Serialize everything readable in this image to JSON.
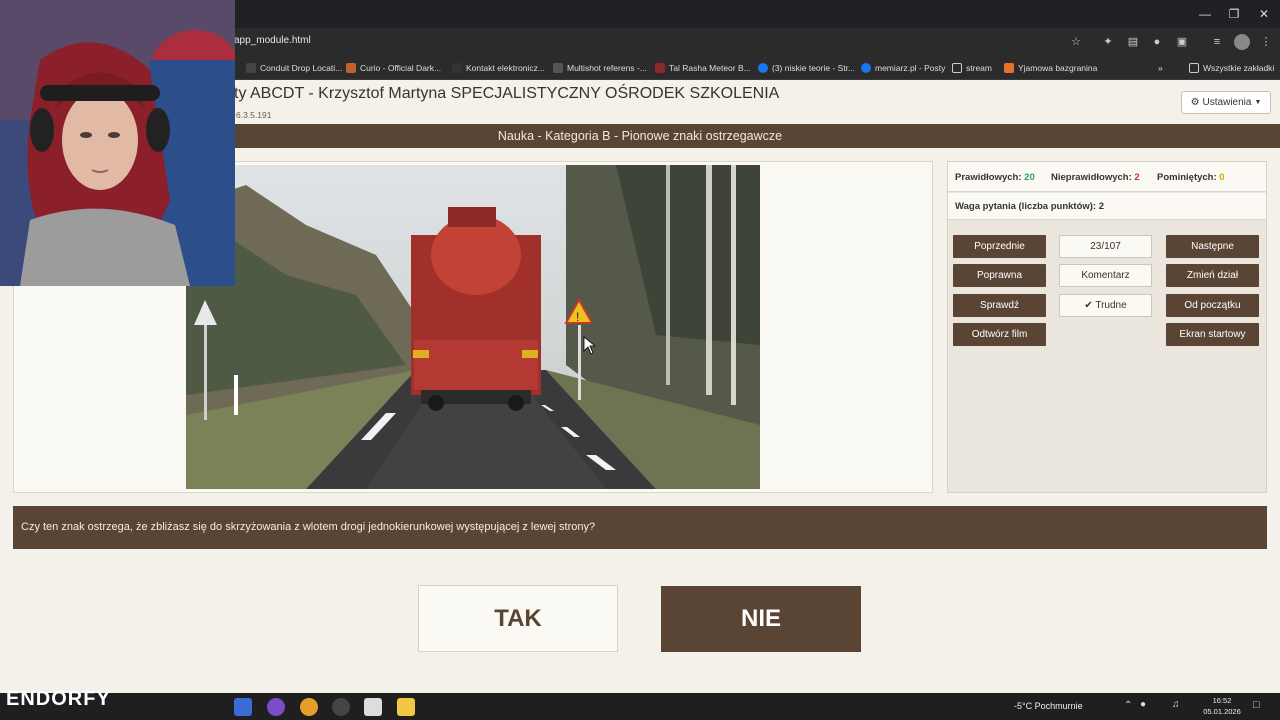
{
  "browser": {
    "url": "app_module.html",
    "bookmarks": [
      "Conduit Drop Locati...",
      "Curio - Official Dark...",
      "Kontakt elektronicz...",
      "Multishot referens -...",
      "Tal Rasha Meteor B...",
      "(3) niskie teorie - Str...",
      "memiarz.pl - Posty",
      "stream",
      "Yjamowa bazgranina"
    ],
    "all_bookmarks": "Wszystkie zakładki"
  },
  "header": {
    "title": "ty ABCDT - Krzysztof Martyna SPECJALISTYCZNY OŚRODEK SZKOLENIA",
    "version": "6.3.5.191",
    "settings_label": "Ustawienia"
  },
  "category_bar": "Nauka - Kategoria B - Pionowe znaki ostrzegawcze",
  "stats": {
    "correct_label": "Prawidłowych:",
    "correct_value": "20",
    "incorrect_label": "Nieprawidłowych:",
    "incorrect_value": "2",
    "skipped_label": "Pominiętych:",
    "skipped_value": "0",
    "weight_label": "Waga pytania (liczba punktów): 2"
  },
  "controls": {
    "previous": "Poprzednie",
    "counter": "23/107",
    "next": "Następne",
    "correct": "Poprawna",
    "comment": "Komentarz",
    "change_section": "Zmień dział",
    "check": "Sprawdź",
    "hard": "Trudne",
    "from_start": "Od początku",
    "play_video": "Odtwórz film",
    "start_screen": "Ekran startowy"
  },
  "question": "Czy ten znak ostrzega, że zbliżasz się do skrzyżowania z wlotem drogi jednokierunkowej występującej z lewej strony?",
  "answers": {
    "yes": "TAK",
    "no": "NIE"
  },
  "taskbar": {
    "brand": "ENDORFY",
    "weather": "-5°C  Pochmurnie",
    "time": "16:52",
    "date": "05.01.2026"
  },
  "colors": {
    "brown": "#5a4535",
    "correct": "#2e9e5b",
    "incorrect": "#c0392b",
    "skipped": "#d4a500"
  }
}
